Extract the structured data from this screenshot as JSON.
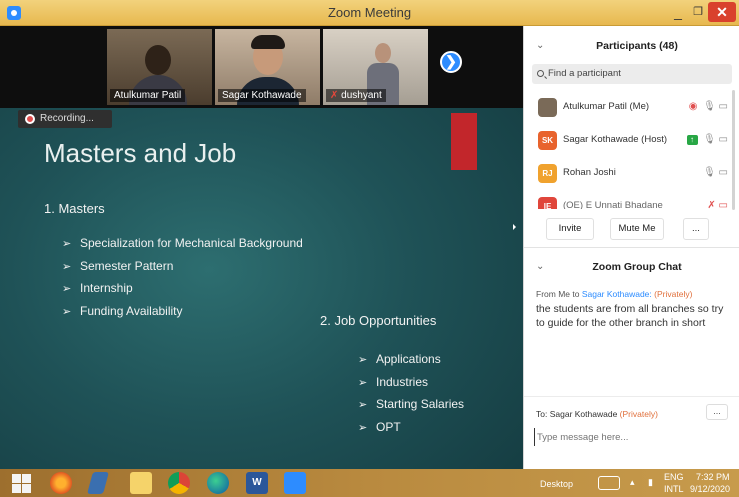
{
  "window": {
    "title": "Zoom Meeting",
    "minimize": "_",
    "maximize": "❐",
    "close": "✕"
  },
  "videos": [
    {
      "name": "Atulkumar Patil",
      "muted": false
    },
    {
      "name": "Sagar Kothawade",
      "muted": false
    },
    {
      "name": "dushyant",
      "muted": true
    }
  ],
  "next_icon": "❯",
  "recording_label": "Recording...",
  "slide": {
    "title": "Masters and Job",
    "section1": "1. Masters",
    "bullets1": [
      "Specialization for Mechanical Background",
      "Semester Pattern",
      "Internship",
      "Funding Availability"
    ],
    "section2": "2. Job Opportunities",
    "bullets2": [
      "Applications",
      "Industries",
      "Starting Salaries",
      "OPT"
    ],
    "bullet_glyph": "➢"
  },
  "participants": {
    "title": "Participants (48)",
    "search_placeholder": "Find a participant",
    "list": [
      {
        "initials": "",
        "name": "Atulkumar Patil (Me)",
        "color": "#7a6a58"
      },
      {
        "initials": "SK",
        "name": "Sagar Kothawade (Host)",
        "color": "#e8632d"
      },
      {
        "initials": "RJ",
        "name": "Rohan Joshi",
        "color": "#f0a22e"
      },
      {
        "initials": "IE",
        "name": "(OE) E Unnati Bhadane",
        "color": "#e0463b"
      }
    ],
    "buttons": {
      "invite": "Invite",
      "mute_me": "Mute Me",
      "more": "..."
    }
  },
  "chat": {
    "title": "Zoom Group Chat",
    "from_prefix": "From Me to",
    "recipient": "Sagar Kothawade:",
    "privately": "(Privately)",
    "message": "the students are from all branches so try to guide for the other branch in short",
    "to_label": "To:",
    "to_name": "Sagar Kothawade",
    "to_privately": "(Privately)",
    "more": "...",
    "input_placeholder": "Type message here..."
  },
  "taskbar": {
    "desktop_label": "Desktop",
    "lang_top": "ENG",
    "lang_bottom": "INTL",
    "time": "7:32 PM",
    "date": "9/12/2020"
  },
  "colors": {
    "zoom_blue": "#2d8cff",
    "record_red": "#e04f4f",
    "accent_orange": "#e0703c"
  }
}
